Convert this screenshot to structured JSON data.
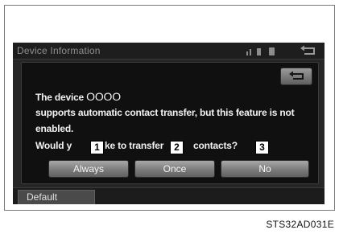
{
  "screen": {
    "title": "Device Information",
    "message": {
      "line1_prefix": "The device",
      "device_name": "OOOO",
      "line2": "supports automatic contact transfer, but this feature is not",
      "line3": "enabled.",
      "line4_a": "Would y",
      "line4_b": "ke to transfer",
      "line4_c": "contacts?"
    },
    "buttons": [
      {
        "label": "Always"
      },
      {
        "label": "Once"
      },
      {
        "label": "No"
      }
    ],
    "default_tab": "Default"
  },
  "callouts": [
    "1",
    "2",
    "3"
  ],
  "figure_code": "STS32AD031E",
  "icons": [
    "signal-icon",
    "battery-icon",
    "phone-icon",
    "back-icon"
  ]
}
